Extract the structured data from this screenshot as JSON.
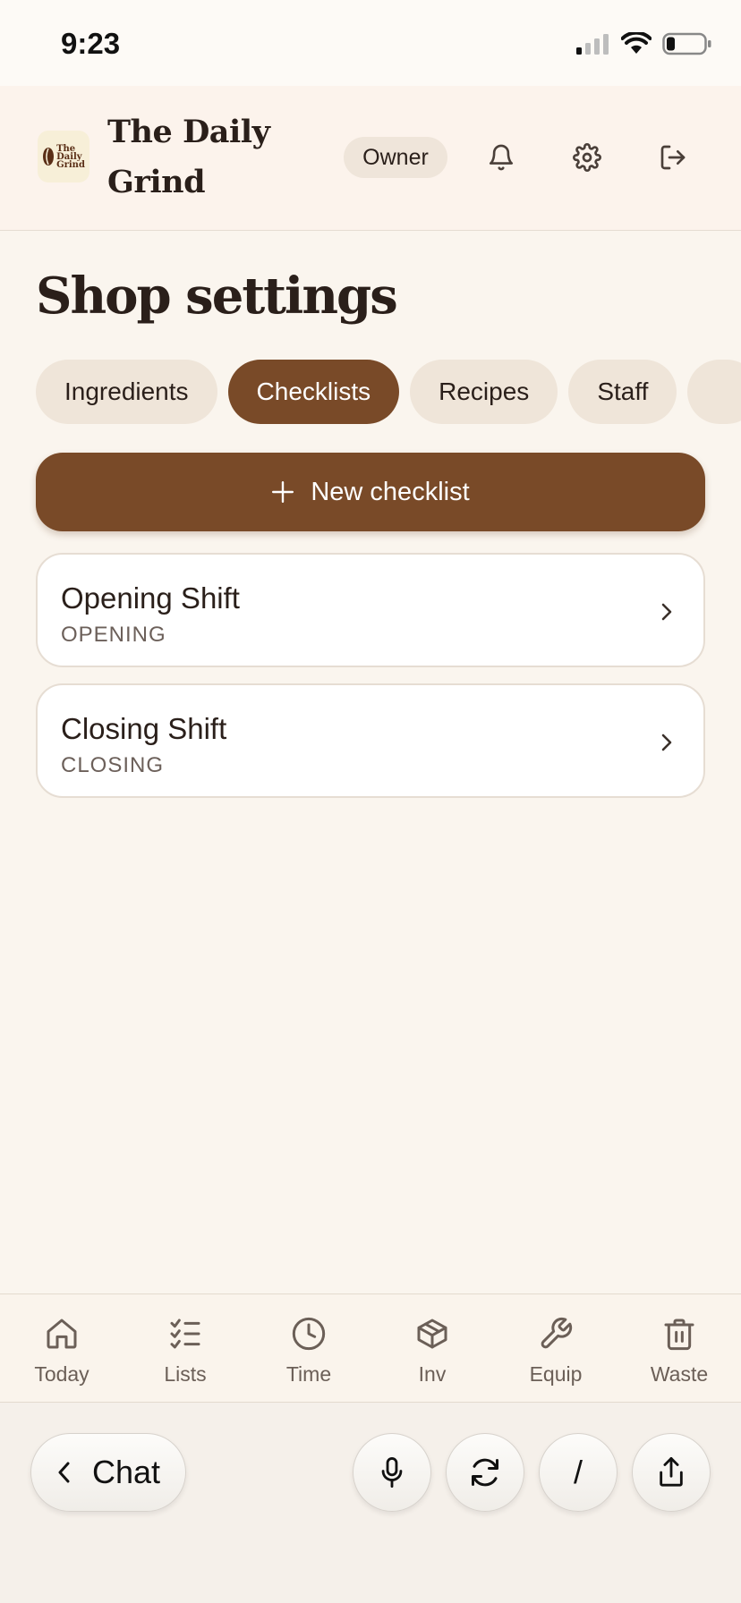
{
  "status_bar": {
    "time": "9:23"
  },
  "header": {
    "logo_lines": [
      "The",
      "Daily",
      "Grind"
    ],
    "brand_line1": "The Daily",
    "brand_line2": "Grind",
    "role": "Owner",
    "icons": [
      "bell-icon",
      "gear-icon",
      "logout-icon"
    ]
  },
  "page": {
    "title": "Shop settings",
    "tabs": [
      {
        "label": "Ingredients",
        "active": false
      },
      {
        "label": "Checklists",
        "active": true
      },
      {
        "label": "Recipes",
        "active": false
      },
      {
        "label": "Staff",
        "active": false
      }
    ],
    "new_button_label": "New checklist",
    "checklists": [
      {
        "title": "Opening Shift",
        "type": "OPENING"
      },
      {
        "title": "Closing Shift",
        "type": "CLOSING"
      }
    ]
  },
  "bottom_nav": [
    {
      "label": "Today",
      "icon": "home-icon"
    },
    {
      "label": "Lists",
      "icon": "checklist-icon"
    },
    {
      "label": "Time",
      "icon": "clock-icon"
    },
    {
      "label": "Inv",
      "icon": "box-icon"
    },
    {
      "label": "Equip",
      "icon": "wrench-icon"
    },
    {
      "label": "Waste",
      "icon": "trash-icon"
    }
  ],
  "toolbar": {
    "chat_label": "Chat",
    "slash_label": "/"
  },
  "colors": {
    "accent": "#794a28",
    "background": "#faf5ee",
    "tab_bg": "#efe5d9"
  }
}
